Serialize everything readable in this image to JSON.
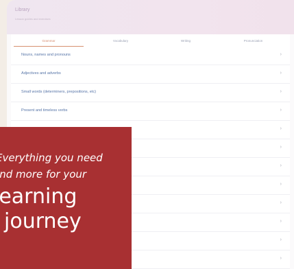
{
  "header": {
    "title": "Library",
    "subtitle": "Lesson guides and exercises"
  },
  "tabs": [
    {
      "label": "Grammar",
      "active": true
    },
    {
      "label": "Vocabulary",
      "active": false
    },
    {
      "label": "Writing",
      "active": false
    },
    {
      "label": "Pronunciation",
      "active": false
    }
  ],
  "list": {
    "items": [
      {
        "label": "Nouns, names and pronouns"
      },
      {
        "label": "Adjectives and adverbs"
      },
      {
        "label": "Small words (determiners, prepositions, etc)"
      },
      {
        "label": "Present and timeless verbs"
      },
      {
        "label": ""
      },
      {
        "label": ""
      },
      {
        "label": ""
      },
      {
        "label": ""
      },
      {
        "label": ""
      },
      {
        "label": ""
      },
      {
        "label": ""
      },
      {
        "label": ""
      }
    ]
  },
  "promo": {
    "line1": "Everything you need",
    "line2": "and more for your",
    "line3": "learning",
    "line4": "journey"
  },
  "colors": {
    "promo_background": "#a83032",
    "accent_tab": "#d6906f",
    "link_text": "#5674a7"
  }
}
